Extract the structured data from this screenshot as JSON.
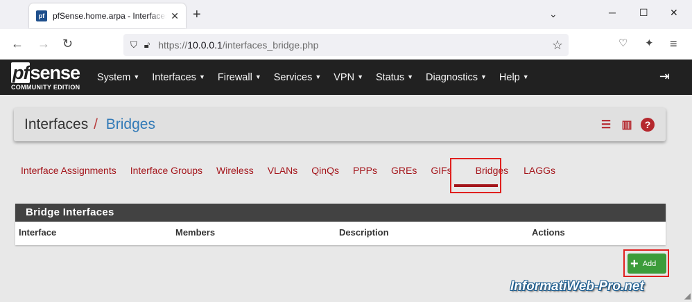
{
  "browser": {
    "tab_title": "pfSense.home.arpa - Interfaces: Bridges",
    "tab_favicon": "pf",
    "url_prefix": "https://",
    "url_host": "10.0.0.1",
    "url_path": "/interfaces_bridge.php"
  },
  "pfsense": {
    "logo_main": "sense",
    "logo_pf": "pf",
    "logo_sub": "COMMUNITY EDITION",
    "menu": [
      "System",
      "Interfaces",
      "Firewall",
      "Services",
      "VPN",
      "Status",
      "Diagnostics",
      "Help"
    ]
  },
  "page": {
    "breadcrumb_parent": "Interfaces",
    "breadcrumb_sep": "/",
    "breadcrumb_current": "Bridges",
    "subtabs": [
      "Interface Assignments",
      "Interface Groups",
      "Wireless",
      "VLANs",
      "QinQs",
      "PPPs",
      "GREs",
      "GIFs",
      "Bridges",
      "LAGGs"
    ],
    "active_subtab": "Bridges"
  },
  "panel": {
    "title": "Bridge Interfaces",
    "columns": [
      "Interface",
      "Members",
      "Description",
      "Actions"
    ]
  },
  "add_button": {
    "label": "Add"
  },
  "watermark": "InformatiWeb-Pro.net",
  "colors": {
    "accent_red": "#a4151b",
    "pf_dark": "#212121",
    "link_blue": "#327ab7",
    "add_green": "#3c9c3a",
    "highlight": "#e0201e"
  }
}
